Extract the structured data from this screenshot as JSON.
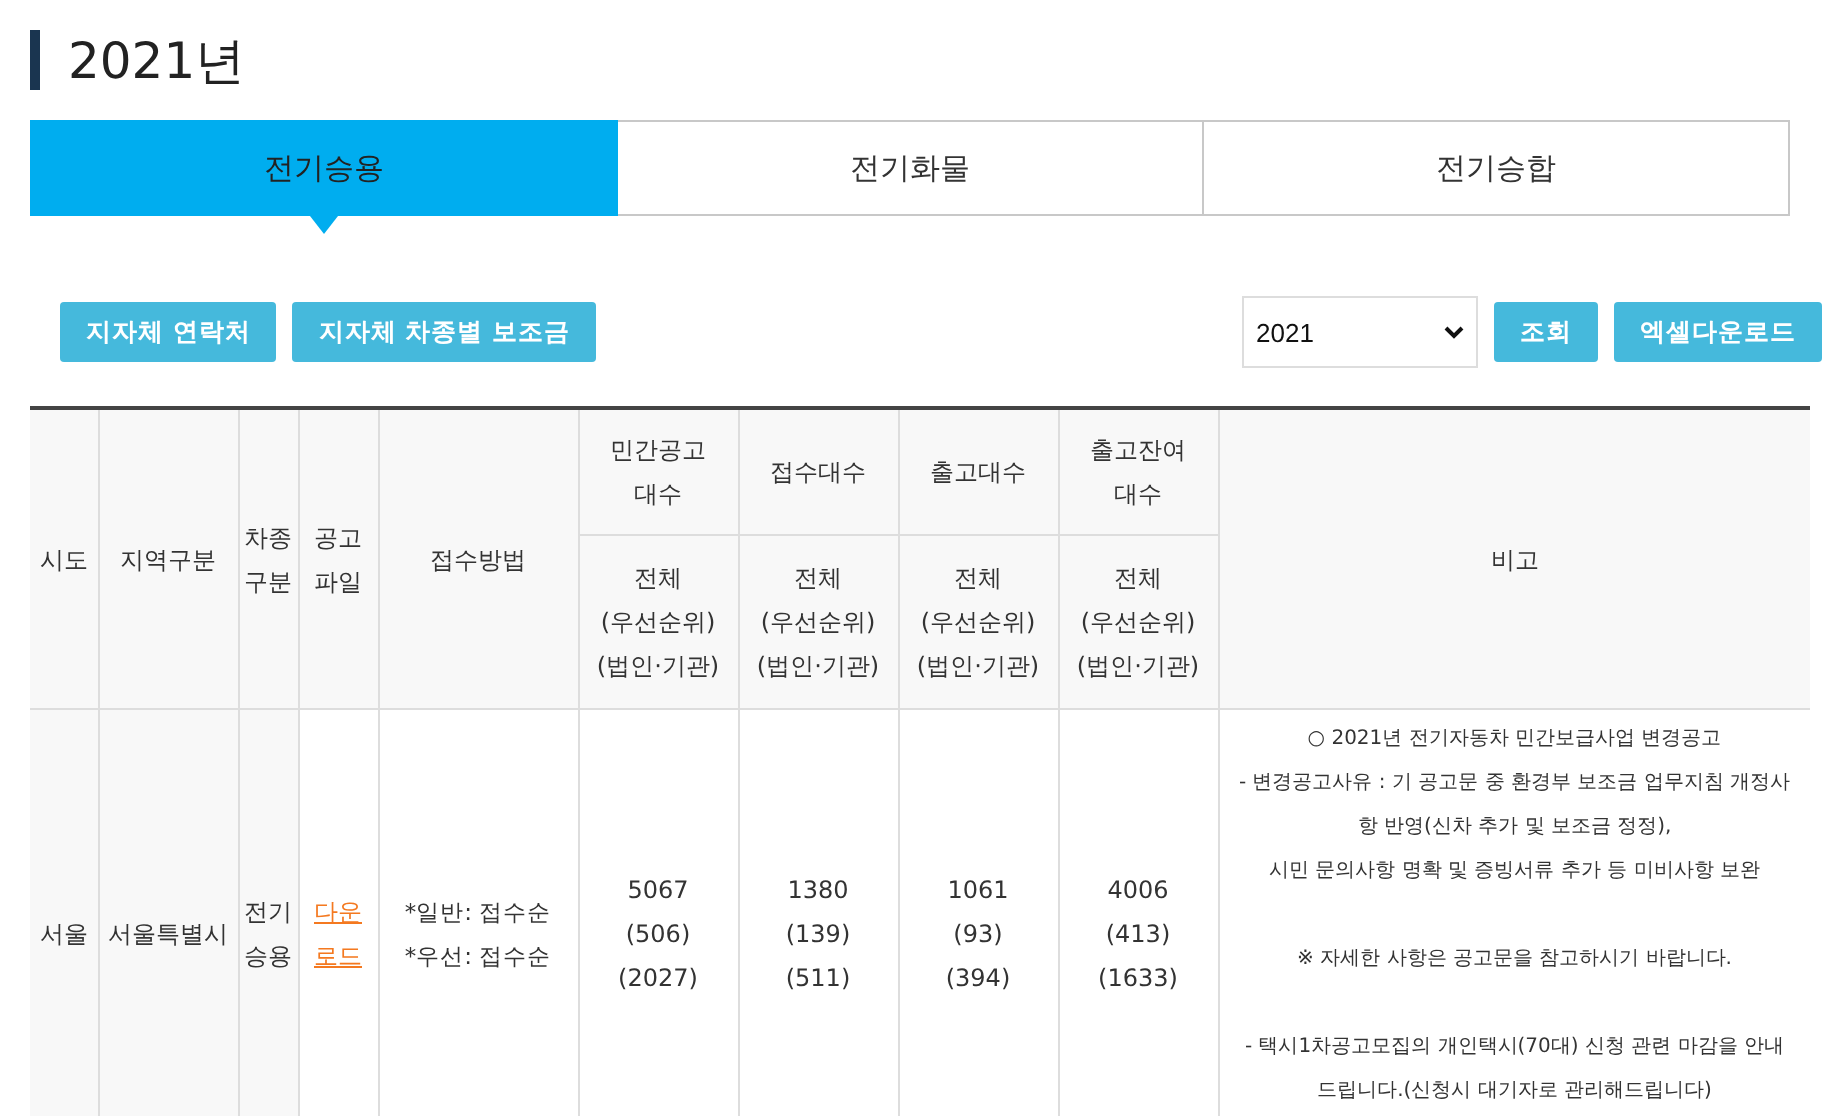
{
  "page_title": "2021년",
  "tabs": [
    {
      "label": "전기승용",
      "selected": true
    },
    {
      "label": "전기화물",
      "selected": false
    },
    {
      "label": "전기승합",
      "selected": false
    }
  ],
  "left_buttons": [
    "지자체 연락처",
    "지자체 차종별 보조금"
  ],
  "year_select": {
    "value": "2021"
  },
  "right_buttons": [
    "조회",
    "엑셀다운로드"
  ],
  "table": {
    "columns": [
      {
        "kind": "single",
        "label": "시도"
      },
      {
        "kind": "single",
        "label": "지역구분"
      },
      {
        "kind": "single",
        "label": "차종 구분"
      },
      {
        "kind": "single",
        "label": "공고 파일"
      },
      {
        "kind": "single",
        "label": "접수방법"
      },
      {
        "kind": "group",
        "label": "민간공고 대수",
        "sub": [
          "전체",
          "(우선순위)",
          "(법인·기관)"
        ]
      },
      {
        "kind": "group",
        "label": "접수대수",
        "sub": [
          "전체",
          "(우선순위)",
          "(법인·기관)"
        ]
      },
      {
        "kind": "group",
        "label": "출고대수",
        "sub": [
          "전체",
          "(우선순위)",
          "(법인·기관)"
        ]
      },
      {
        "kind": "group",
        "label": "출고잔여 대수",
        "sub": [
          "전체",
          "(우선순위)",
          "(법인·기관)"
        ]
      },
      {
        "kind": "single",
        "label": "비고"
      }
    ],
    "rows": [
      {
        "sido": "서울",
        "region": "서울특별시",
        "vehicle_type": "전기 승용",
        "file_link": "다운로드",
        "method": [
          "*일반: 접수순",
          "*우선: 접수순"
        ],
        "counts": [
          [
            "5067",
            "(506)",
            "(2027)"
          ],
          [
            "1380",
            "(139)",
            "(511)"
          ],
          [
            "1061",
            "(93)",
            "(394)"
          ],
          [
            "4006",
            "(413)",
            "(1633)"
          ]
        ],
        "remarks": [
          [
            "○ 2021년 전기자동차 민간보급사업 변경공고",
            "- 변경공고사유 : 기 공고문 중 환경부 보조금 업무지침 개정사",
            "항 반영(신차 추가 및 보조금 정정),",
            "시민 문의사항 명확 및 증빙서류 추가 등 미비사항 보완"
          ],
          [
            "※ 자세한 사항은 공고문을 참고하시기 바랍니다."
          ],
          [
            "- 택시1차공고모집의 개인택시(70대) 신청 관련 마감을 안내",
            "드립니다.(신청시 대기자로 관리해드립니다)"
          ]
        ]
      }
    ]
  }
}
